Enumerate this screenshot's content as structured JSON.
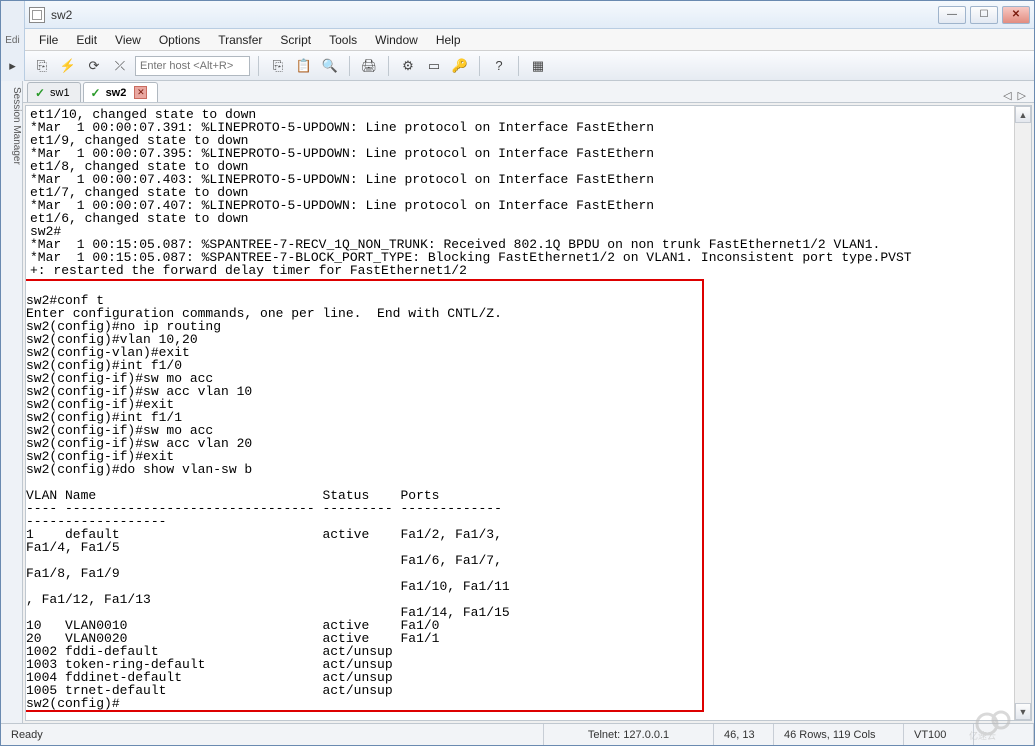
{
  "window": {
    "title": "sw2"
  },
  "menus": [
    "File",
    "Edit",
    "View",
    "Options",
    "Transfer",
    "Script",
    "Tools",
    "Window",
    "Help"
  ],
  "host_placeholder": "Enter host <Alt+R>",
  "sidebar_label": "Session Manager",
  "tabs": [
    {
      "name": "sw1",
      "active": false
    },
    {
      "name": "sw2",
      "active": true
    }
  ],
  "terminal_top": "et1/10, changed state to down\n*Mar  1 00:00:07.391: %LINEPROTO-5-UPDOWN: Line protocol on Interface FastEthern\net1/9, changed state to down\n*Mar  1 00:00:07.395: %LINEPROTO-5-UPDOWN: Line protocol on Interface FastEthern\net1/8, changed state to down\n*Mar  1 00:00:07.403: %LINEPROTO-5-UPDOWN: Line protocol on Interface FastEthern\net1/7, changed state to down\n*Mar  1 00:00:07.407: %LINEPROTO-5-UPDOWN: Line protocol on Interface FastEthern\net1/6, changed state to down\nsw2#\n*Mar  1 00:15:05.087: %SPANTREE-7-RECV_1Q_NON_TRUNK: Received 802.1Q BPDU on non trunk FastEthernet1/2 VLAN1.\n*Mar  1 00:15:05.087: %SPANTREE-7-BLOCK_PORT_TYPE: Blocking FastEthernet1/2 on VLAN1. Inconsistent port type.PVST\n+: restarted the forward delay timer for FastEthernet1/2\n",
  "terminal_box": "\nsw2#conf t\nEnter configuration commands, one per line.  End with CNTL/Z.\nsw2(config)#no ip routing\nsw2(config)#vlan 10,20\nsw2(config-vlan)#exit\nsw2(config)#int f1/0\nsw2(config-if)#sw mo acc\nsw2(config-if)#sw acc vlan 10\nsw2(config-if)#exit\nsw2(config)#int f1/1\nsw2(config-if)#sw mo acc\nsw2(config-if)#sw acc vlan 20\nsw2(config-if)#exit\nsw2(config)#do show vlan-sw b\n\nVLAN Name                             Status    Ports\n---- -------------------------------- --------- -------------\n------------------\n1    default                          active    Fa1/2, Fa1/3,\nFa1/4, Fa1/5\n                                                Fa1/6, Fa1/7,\nFa1/8, Fa1/9\n                                                Fa1/10, Fa1/11\n, Fa1/12, Fa1/13\n                                                Fa1/14, Fa1/15\n10   VLAN0010                         active    Fa1/0\n20   VLAN0020                         active    Fa1/1\n1002 fddi-default                     act/unsup\n1003 token-ring-default               act/unsup\n1004 fddinet-default                  act/unsup\n1005 trnet-default                    act/unsup\nsw2(config)#",
  "status": {
    "ready": "Ready",
    "conn": "Telnet: 127.0.0.1",
    "pos": "46,  13",
    "size": "46 Rows, 119 Cols",
    "term": "VT100"
  },
  "watermark_text": "亿速云"
}
